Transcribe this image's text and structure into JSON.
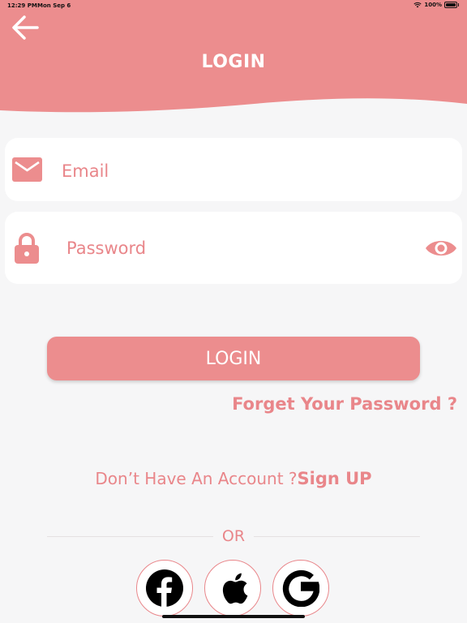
{
  "status_bar": {
    "time": "12:29 PM",
    "date": "Mon Sep 6",
    "battery": "100%"
  },
  "header": {
    "title": "LOGIN",
    "back_icon": "arrow-left-icon"
  },
  "form": {
    "email": {
      "placeholder": "Email",
      "value": "",
      "icon": "mail-icon"
    },
    "password": {
      "placeholder": "Password",
      "value": "",
      "icon": "lock-icon",
      "toggle_icon": "eye-icon"
    },
    "login_label": "LOGIN",
    "forgot_label": "Forget Your Password ?"
  },
  "signup": {
    "prompt": "Don’t Have An Account ?",
    "link": "Sign UP"
  },
  "social": {
    "or_label": "OR",
    "buttons": [
      {
        "name": "facebook",
        "icon": "facebook-icon"
      },
      {
        "name": "apple",
        "icon": "apple-icon"
      },
      {
        "name": "google",
        "icon": "google-icon"
      }
    ]
  },
  "colors": {
    "accent": "#ec8d8e",
    "text_accent": "#e9868a",
    "background": "#f6f6f7",
    "field_bg": "#ffffff"
  }
}
